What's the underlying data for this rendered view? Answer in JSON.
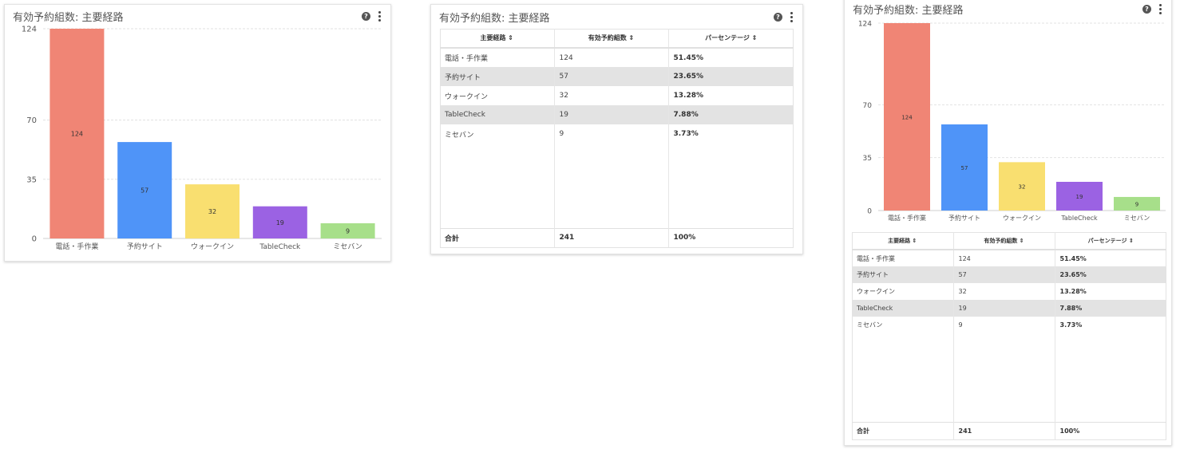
{
  "widgets": {
    "chart_title": "有効予約組数: 主要経路",
    "table_title": "有効予約組数: 主要経路",
    "combo_title": "有効予約組数: 主要経路"
  },
  "icons": {
    "help": "help-circle-icon",
    "more": "more-vertical-icon",
    "sort": "sort-icon"
  },
  "table": {
    "headers": [
      "主要経路 ⇕",
      "有効予約組数 ⇕",
      "パーセンテージ ⇕"
    ],
    "rows": [
      [
        "電話・手作業",
        "124",
        "51.45%"
      ],
      [
        "予約サイト",
        "57",
        "23.65%"
      ],
      [
        "ウォークイン",
        "32",
        "13.28%"
      ],
      [
        "TableCheck",
        "19",
        "7.88%"
      ],
      [
        "ミセバン",
        "9",
        "3.73%"
      ]
    ],
    "total": [
      "合計",
      "241",
      "100%"
    ]
  },
  "chart_data": {
    "type": "bar",
    "categories": [
      "電話・手作業",
      "予約サイト",
      "ウォークイン",
      "TableCheck",
      "ミセバン"
    ],
    "values": [
      124,
      57,
      32,
      19,
      9
    ],
    "colors": [
      "#f08575",
      "#4f94f8",
      "#f9df70",
      "#9b62e3",
      "#a7df8a"
    ],
    "yticks": [
      0,
      35,
      70,
      124
    ],
    "ylim": [
      0,
      124
    ],
    "title": "",
    "xlabel": "",
    "ylabel": "",
    "grid": true
  }
}
